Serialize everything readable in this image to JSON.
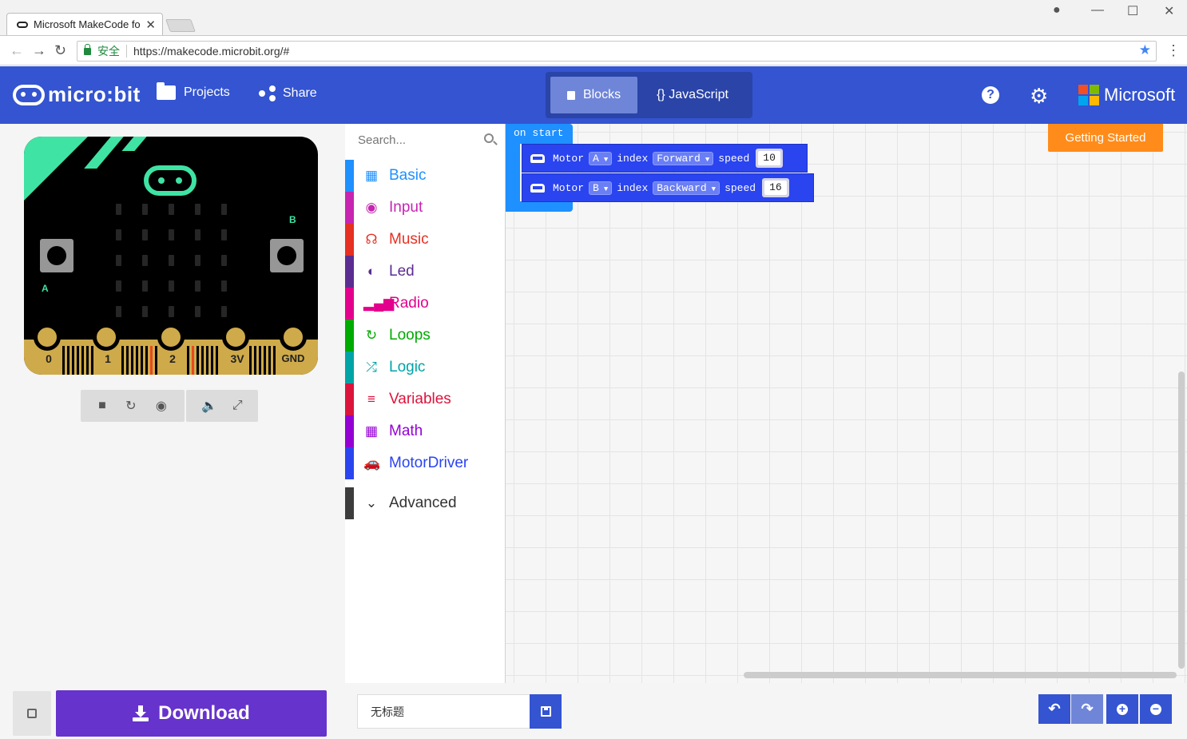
{
  "browser": {
    "tab_title": "Microsoft MakeCode fo",
    "secure_label": "安全",
    "url": "https://makecode.microbit.org/#"
  },
  "header": {
    "logo_text": "micro:bit",
    "projects_label": "Projects",
    "share_label": "Share",
    "blocks_label": "Blocks",
    "javascript_label": "{} JavaScript",
    "microsoft_label": "Microsoft",
    "help_glyph": "?",
    "gear_glyph": "⚙"
  },
  "simulator": {
    "button_a": "A",
    "button_b": "B",
    "pins": [
      "0",
      "1",
      "2",
      "3V",
      "GND"
    ],
    "toolbar_icons": [
      "stop-icon",
      "restart-icon",
      "debug-icon",
      "mute-icon",
      "fullscreen-icon"
    ]
  },
  "toolbox": {
    "search_placeholder": "Search...",
    "categories": [
      {
        "label": "Basic",
        "color": "#1e90ff",
        "icon": "grid-icon"
      },
      {
        "label": "Input",
        "color": "#c724b1",
        "icon": "target-icon"
      },
      {
        "label": "Music",
        "color": "#e63022",
        "icon": "headphones-icon"
      },
      {
        "label": "Led",
        "color": "#5c2d91",
        "icon": "toggle-icon"
      },
      {
        "label": "Radio",
        "color": "#e3008c",
        "icon": "signal-icon"
      },
      {
        "label": "Loops",
        "color": "#00aa00",
        "icon": "refresh-icon"
      },
      {
        "label": "Logic",
        "color": "#00a4a6",
        "icon": "shuffle-icon"
      },
      {
        "label": "Variables",
        "color": "#dc143c",
        "icon": "list-icon"
      },
      {
        "label": "Math",
        "color": "#9400d3",
        "icon": "calculator-icon"
      },
      {
        "label": "MotorDriver",
        "color": "#2a44f0",
        "icon": "car-icon"
      }
    ],
    "advanced_label": "Advanced"
  },
  "workspace": {
    "getting_started_label": "Getting Started",
    "on_start_label": "on start",
    "blocks": [
      {
        "motor_label": "Motor",
        "motor_value": "A",
        "index_label": "index",
        "direction": "Forward",
        "speed_label": "speed",
        "speed": "10"
      },
      {
        "motor_label": "Motor",
        "motor_value": "B",
        "index_label": "index",
        "direction": "Backward",
        "speed_label": "speed",
        "speed": "16"
      }
    ]
  },
  "footer": {
    "download_label": "Download",
    "project_name": "无标题"
  }
}
